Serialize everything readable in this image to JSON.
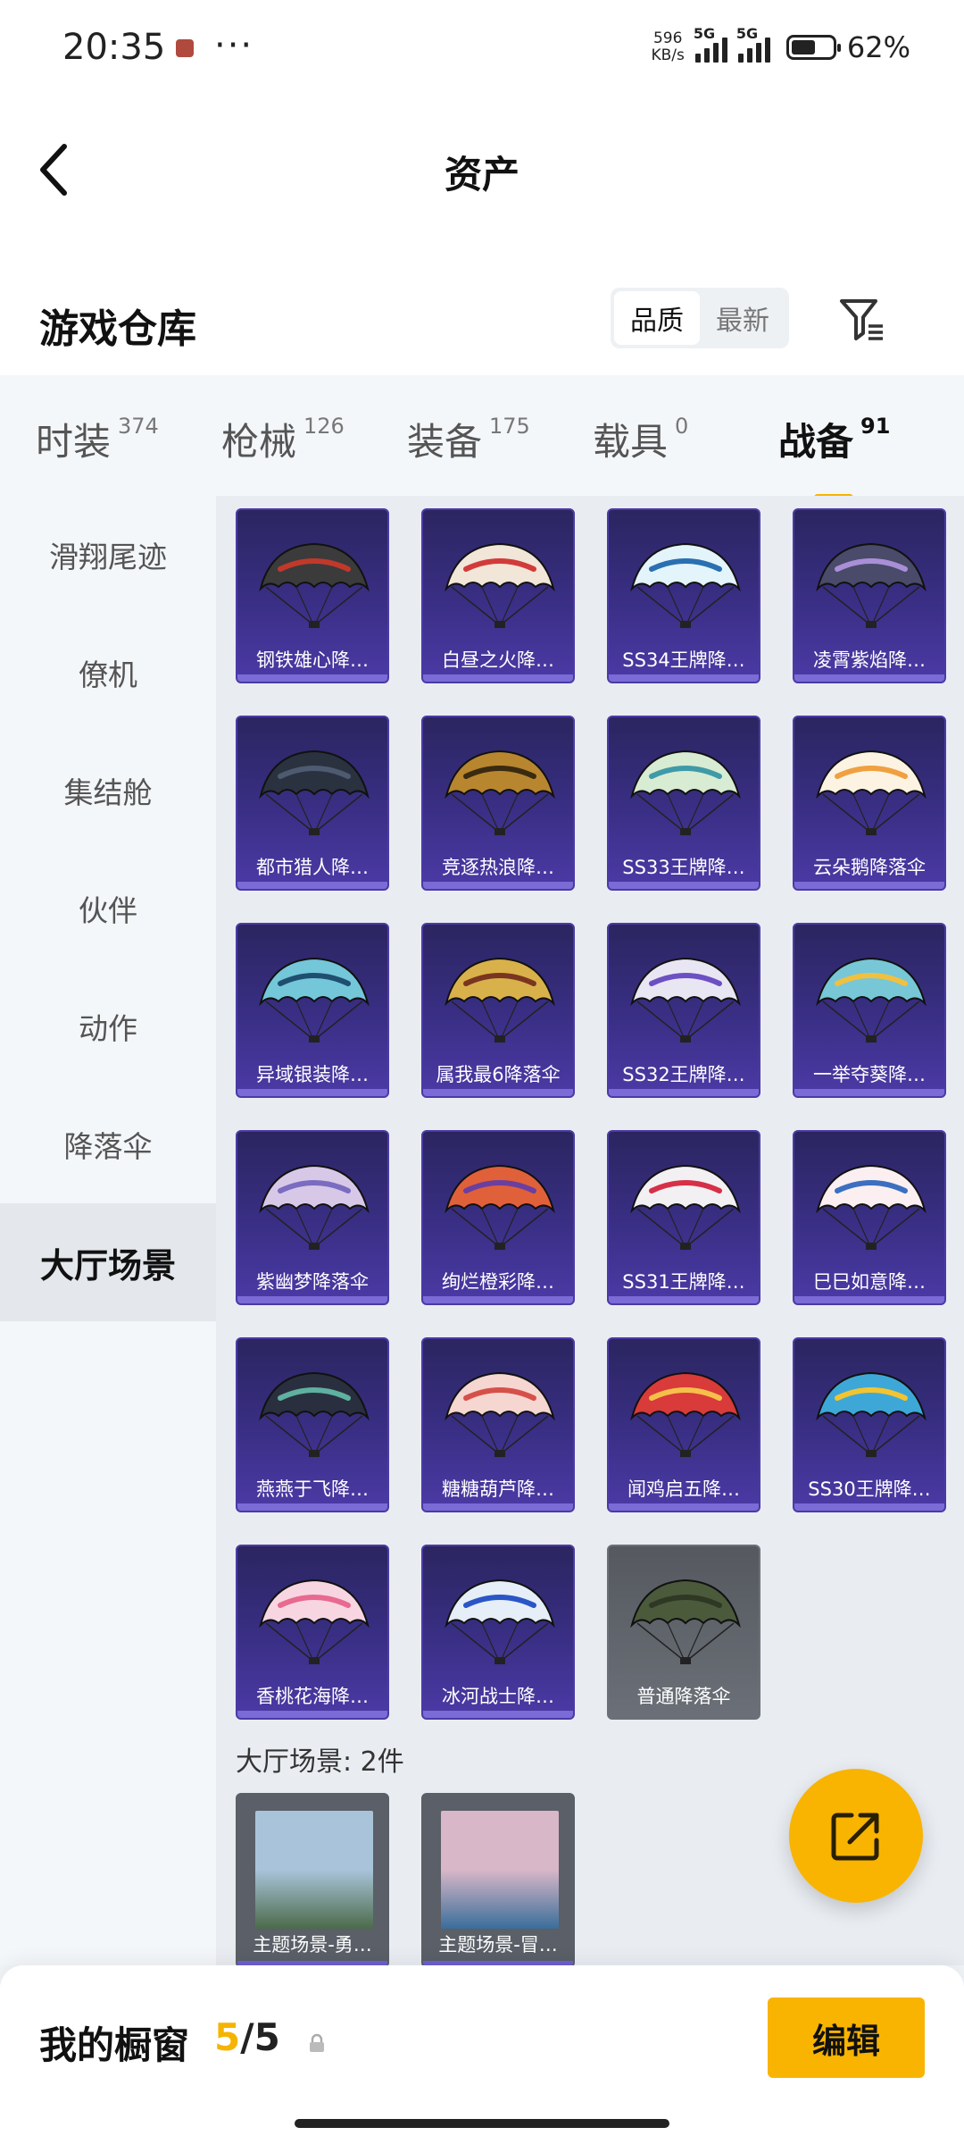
{
  "status_bar": {
    "time": "20:35",
    "dots": "···",
    "net_speed_value": "596",
    "net_speed_unit": "KB/s",
    "signal1_tag": "5G",
    "signal2_tag": "5G",
    "battery": "62%"
  },
  "nav": {
    "title": "资产"
  },
  "warehouse": {
    "title": "游戏仓库"
  },
  "sort": {
    "options": [
      "品质",
      "最新"
    ],
    "selected": "品质"
  },
  "tabs": [
    {
      "label": "时装",
      "count": "374"
    },
    {
      "label": "枪械",
      "count": "126"
    },
    {
      "label": "装备",
      "count": "175"
    },
    {
      "label": "载具",
      "count": "0"
    },
    {
      "label": "战备",
      "count": "91"
    }
  ],
  "active_tab": "战备",
  "sidebar": {
    "items": [
      "滑翔尾迹",
      "僚机",
      "集结舱",
      "伙伴",
      "动作",
      "降落伞",
      "大厅场景"
    ],
    "active": "大厅场景"
  },
  "items": [
    {
      "name": "钢铁雄心降…",
      "color": "#3b3b3b",
      "accent": "#c0392b",
      "rarity": "purple"
    },
    {
      "name": "白昼之火降…",
      "color": "#f1e6d8",
      "accent": "#d23b3b",
      "rarity": "purple"
    },
    {
      "name": "SS34王牌降…",
      "color": "#e3f4fa",
      "accent": "#2a6fb0",
      "rarity": "purple"
    },
    {
      "name": "凌霄紫焰降…",
      "color": "#4a4a6a",
      "accent": "#a98fd6",
      "rarity": "purple"
    },
    {
      "name": "都市猎人降…",
      "color": "#2a3240",
      "accent": "#4d5a70",
      "rarity": "purple"
    },
    {
      "name": "竞逐热浪降…",
      "color": "#b8862f",
      "accent": "#3a2a10",
      "rarity": "purple"
    },
    {
      "name": "SS33王牌降…",
      "color": "#d7ecd3",
      "accent": "#3f9aa8",
      "rarity": "purple"
    },
    {
      "name": "云朵鹅降落伞",
      "color": "#fdf3e3",
      "accent": "#f0a040",
      "rarity": "purple"
    },
    {
      "name": "异域银装降…",
      "color": "#74c6d9",
      "accent": "#1f4f70",
      "rarity": "purple"
    },
    {
      "name": "属我最6降落伞",
      "color": "#d9b14a",
      "accent": "#7a3520",
      "rarity": "purple"
    },
    {
      "name": "SS32王牌降…",
      "color": "#e9e6f3",
      "accent": "#6d4fc4",
      "rarity": "purple"
    },
    {
      "name": "一举夺葵降…",
      "color": "#77c7d6",
      "accent": "#f0c040",
      "rarity": "purple"
    },
    {
      "name": "紫幽梦降落伞",
      "color": "#d8c8e8",
      "accent": "#7a6cc0",
      "rarity": "purple"
    },
    {
      "name": "绚烂橙彩降…",
      "color": "#e0603a",
      "accent": "#6a3fa0",
      "rarity": "purple"
    },
    {
      "name": "SS31王牌降…",
      "color": "#f3f0f3",
      "accent": "#d63048",
      "rarity": "purple"
    },
    {
      "name": "巳巳如意降…",
      "color": "#fbeff1",
      "accent": "#3b6fc0",
      "rarity": "purple"
    },
    {
      "name": "燕燕于飞降…",
      "color": "#2a2f3f",
      "accent": "#5fb0a0",
      "rarity": "purple"
    },
    {
      "name": "糖糖葫芦降…",
      "color": "#f6d6d0",
      "accent": "#d6504a",
      "rarity": "purple"
    },
    {
      "name": "闻鸡启五降…",
      "color": "#d93a3a",
      "accent": "#f5c04a",
      "rarity": "purple"
    },
    {
      "name": "SS30王牌降…",
      "color": "#3da8d8",
      "accent": "#f2c430",
      "rarity": "purple"
    },
    {
      "name": "香桃花海降…",
      "color": "#f7d6e2",
      "accent": "#e86a90",
      "rarity": "purple"
    },
    {
      "name": "冰河战士降…",
      "color": "#e6eef8",
      "accent": "#2a56c6",
      "rarity": "purple"
    },
    {
      "name": "普通降落伞",
      "color": "#4b5a3a",
      "accent": "#2e3825",
      "rarity": "gray"
    }
  ],
  "lobby_section": {
    "label": "大厅场景: 2件"
  },
  "lobby_scenes": [
    {
      "name": "主题场景-勇…",
      "sky": "#a9c4da",
      "ground": "#4c6b4a"
    },
    {
      "name": "主题场景-冒…",
      "sky": "#d8b7c8",
      "ground": "#3a6e9a"
    }
  ],
  "bottom_bar": {
    "title": "我的橱窗",
    "current": "5",
    "separator": "/",
    "total": "5",
    "edit_label": "编辑"
  },
  "colors": {
    "accent": "#f8b400",
    "purple_card": "#3a2f86"
  }
}
